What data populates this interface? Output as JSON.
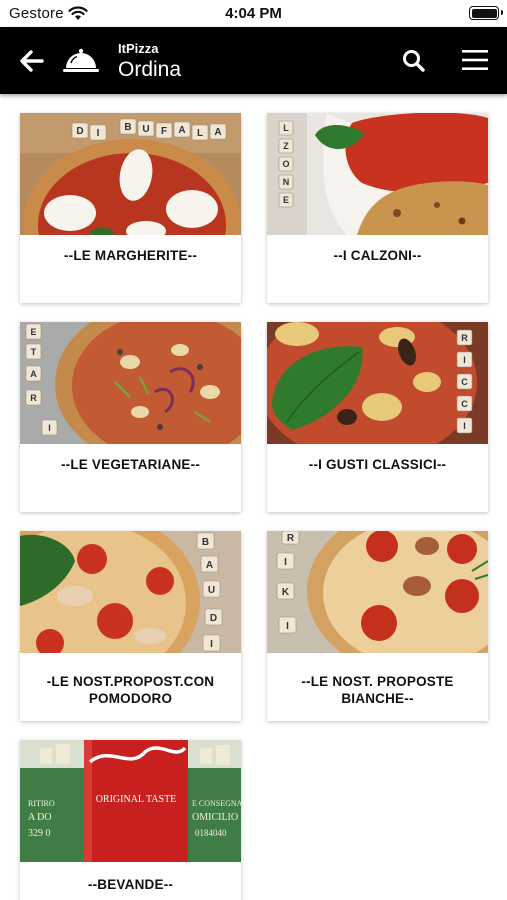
{
  "status_bar": {
    "carrier": "Gestore",
    "time": "4:04 PM"
  },
  "header": {
    "app_name": "ItPizza",
    "title": "Ordina",
    "icons": [
      "back-arrow-icon",
      "cloche-icon",
      "search-icon",
      "menu-icon"
    ]
  },
  "categories": [
    {
      "label": "--LE MARGHERITE--",
      "image_tiles": [
        "D",
        "I",
        "B",
        "U",
        "F",
        "A",
        "L",
        "A"
      ]
    },
    {
      "label": "--I CALZONI--",
      "image_tiles": [
        "L",
        "Z",
        "O",
        "N",
        "E"
      ]
    },
    {
      "label": "--LE VEGETARIANE--",
      "image_tiles": [
        "E",
        "T",
        "A",
        "R",
        "I"
      ]
    },
    {
      "label": "--I GUSTI CLASSICI--",
      "image_tiles": [
        "R",
        "I",
        "C",
        "C",
        "I"
      ]
    },
    {
      "label": "-LE NOST.PROPOST.CON POMODORO",
      "image_tiles": [
        "B",
        "A",
        "U",
        "D",
        "I"
      ]
    },
    {
      "label": "--LE NOST. PROPOSTE BIANCHE--",
      "image_tiles": [
        "R",
        "I",
        "K",
        "I"
      ]
    },
    {
      "label": "--BEVANDE--",
      "image_tiles": []
    }
  ],
  "bevande_image_text": {
    "line1": "ORIGINAL TASTE",
    "left_text": [
      "RITIRO",
      "A DO",
      "329 0"
    ],
    "right_text": [
      "E CONSEGNA",
      "OMICILIO",
      "0184040"
    ]
  }
}
